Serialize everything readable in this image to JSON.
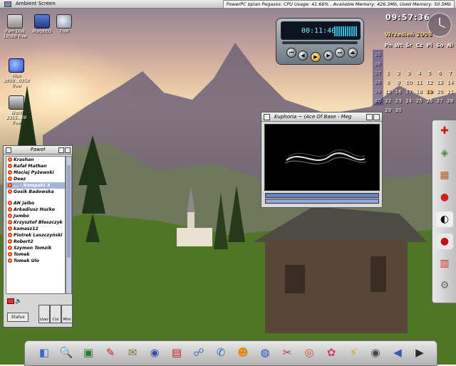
{
  "menubar": {
    "title": "Ambient Screen",
    "status": "PowerPC bplan Pegasos: CPU Usage: 41.66% , Available Memory: 426.3Mb, Used Memory: 50.5Mb"
  },
  "desktop_icons": [
    {
      "label": "Ram Disk",
      "sub": "1208B free",
      "icon": "ram-disk-icon"
    },
    {
      "label": "MorphOS",
      "sub": "",
      "icon": "morphos-icon"
    },
    {
      "label": "TNM",
      "sub": "",
      "icon": "tnm-icon"
    },
    {
      "label": "Mos",
      "sub": "2910...0258 free",
      "icon": "mos-drive-icon"
    },
    {
      "label": "Work",
      "sub": "2355...08 free",
      "icon": "work-drive-icon"
    }
  ],
  "clock": {
    "time": "09:57:36"
  },
  "calendar": {
    "month": "Wrzesień 2008",
    "headers": [
      "",
      "Pn",
      "Wt",
      "Śr",
      "Cz",
      "Pi",
      "So",
      "Ni"
    ],
    "weeks": [
      [
        "35",
        "",
        "",
        "",
        "",
        "",
        "",
        ""
      ],
      [
        "36",
        "",
        "",
        "",
        "",
        "",
        "",
        ""
      ],
      [
        "37",
        "1",
        "2",
        "3",
        "4",
        "5",
        "6",
        "7"
      ],
      [
        "38",
        "8",
        "9",
        "10",
        "11",
        "12",
        "13",
        "14"
      ],
      [
        "39",
        "15",
        "16",
        "17",
        "18",
        "19",
        "20",
        "21"
      ],
      [
        "40",
        "22",
        "23",
        "24",
        "25",
        "26",
        "27",
        "28"
      ],
      [
        "",
        "29",
        "30",
        "",
        "",
        "",
        "",
        ""
      ]
    ],
    "today": "19"
  },
  "player": {
    "time": "00:11:40"
  },
  "euphoria": {
    "title": "Euphoria ~ (Ace Of Base - Meg"
  },
  "buddy": {
    "title": "Paweł",
    "contacts": [
      {
        "name": "Krashan",
        "sel": false
      },
      {
        "name": "Rafał Mathan",
        "sel": false
      },
      {
        "name": "Maciej Pyżewski",
        "sel": false
      },
      {
        "name": "Deez",
        "sel": false
      },
      {
        "name": "... - Kompakt X",
        "sel": true
      },
      {
        "name": "Gosik Badowska",
        "sel": false
      },
      {
        "name": "",
        "sel": false
      },
      {
        "name": "AN jaibo",
        "sel": false
      },
      {
        "name": "Arkadiusz Hućko",
        "sel": false
      },
      {
        "name": "Jumbo",
        "sel": false
      },
      {
        "name": "Krzysztof Błaszczyk",
        "sel": false
      },
      {
        "name": "kamasz12",
        "sel": false
      },
      {
        "name": "Piotrek Leszczyński",
        "sel": false
      },
      {
        "name": "Robert2",
        "sel": false
      },
      {
        "name": "Szymon Tomzik",
        "sel": false
      },
      {
        "name": "Tomek",
        "sel": false
      },
      {
        "name": "Tomek Ulo",
        "sel": false
      }
    ],
    "status_label": "Status",
    "buttons": [
      "User",
      "Ctx",
      "Mini"
    ]
  },
  "right_dock": [
    "aros-icon",
    "quake-icon",
    "game-icon",
    "mouse-icon",
    "yinyang-icon",
    "record-icon",
    "chart-icon",
    "tools-icon"
  ],
  "bottom_dock": [
    "finder-icon",
    "search-icon",
    "monitor-icon",
    "pdf-icon",
    "editor-icon",
    "browser-icon",
    "calendar-icon",
    "network-icon",
    "chat-icon",
    "buddy-icon",
    "globe-icon",
    "clipboard-icon",
    "mplayer-icon",
    "paint-icon",
    "lightning-icon",
    "dvd-icon",
    "sound-icon",
    "mplayer-logo-icon"
  ]
}
